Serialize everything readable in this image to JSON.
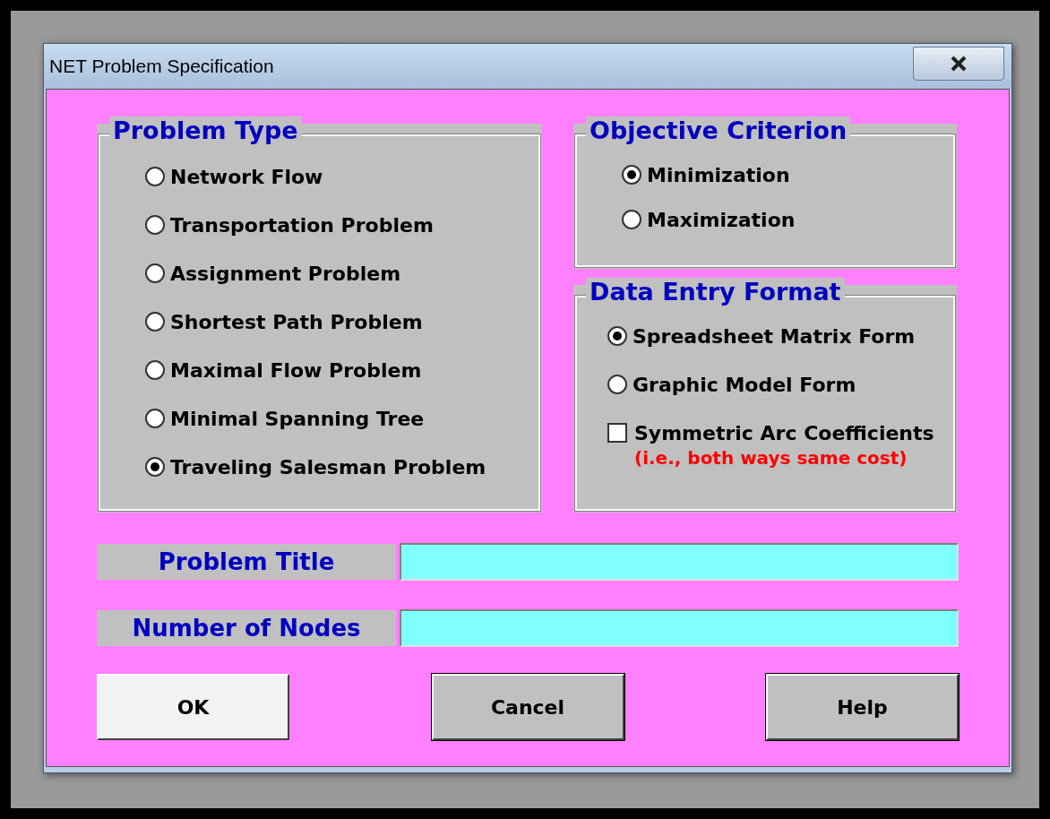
{
  "window": {
    "title": "NET Problem Specification"
  },
  "problem_type": {
    "title": "Problem Type",
    "options": [
      {
        "label": "Network Flow",
        "selected": false
      },
      {
        "label": "Transportation Problem",
        "selected": false
      },
      {
        "label": "Assignment Problem",
        "selected": false
      },
      {
        "label": "Shortest Path Problem",
        "selected": false
      },
      {
        "label": "Maximal Flow Problem",
        "selected": false
      },
      {
        "label": "Minimal Spanning Tree",
        "selected": false
      },
      {
        "label": "Traveling Salesman Problem",
        "selected": true
      }
    ]
  },
  "objective": {
    "title": "Objective Criterion",
    "options": [
      {
        "label": "Minimization",
        "selected": true
      },
      {
        "label": "Maximization",
        "selected": false
      }
    ]
  },
  "data_entry": {
    "title": "Data Entry Format",
    "options": [
      {
        "label": "Spreadsheet Matrix Form",
        "selected": true
      },
      {
        "label": "Graphic Model Form",
        "selected": false
      }
    ],
    "symmetric": {
      "label": "Symmetric Arc Coefficients",
      "note": "(i.e., both ways same cost)",
      "checked": false
    }
  },
  "fields": [
    {
      "label": "Problem Title"
    },
    {
      "label": "Number of Nodes"
    }
  ],
  "buttons": [
    {
      "label": "OK",
      "focused": true
    },
    {
      "label": "Cancel",
      "focused": false
    },
    {
      "label": "Help",
      "focused": false
    }
  ]
}
